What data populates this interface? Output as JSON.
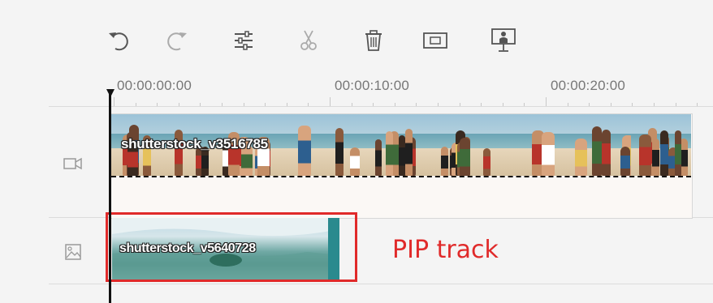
{
  "toolbar": {
    "buttons": [
      {
        "name": "undo",
        "icon": "undo-icon",
        "enabled": true
      },
      {
        "name": "redo",
        "icon": "redo-icon",
        "enabled": false
      },
      {
        "name": "adjust",
        "icon": "sliders-icon",
        "enabled": true
      },
      {
        "name": "split",
        "icon": "scissors-icon",
        "enabled": false
      },
      {
        "name": "delete",
        "icon": "trash-icon",
        "enabled": true
      },
      {
        "name": "crop",
        "icon": "crop-icon",
        "enabled": true
      },
      {
        "name": "presenter",
        "icon": "presenter-icon",
        "enabled": true
      }
    ]
  },
  "ruler": {
    "labels": [
      "00:00:00:00",
      "00:00:10:00",
      "00:00:20:00"
    ]
  },
  "tracks": {
    "video": {
      "icon": "video-camera-icon",
      "clip_label": "shutterstock_v3516785"
    },
    "pip": {
      "icon": "image-icon",
      "clip_label": "shutterstock_v5640728"
    }
  },
  "annotation": {
    "text": "PIP track",
    "color": "#e02a2a"
  },
  "colors": {
    "background": "#f4f4f4",
    "playhead": "#111111",
    "highlight": "#e02a2a"
  }
}
